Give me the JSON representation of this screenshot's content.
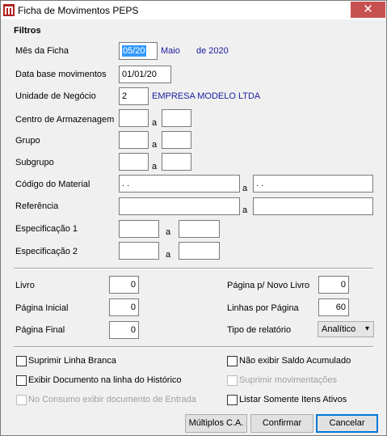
{
  "window": {
    "title": "Ficha de Movimentos PEPS",
    "close_glyph": "✕",
    "app_icon": "peps-app-icon"
  },
  "filters": {
    "group_title": "Filtros",
    "mes_ficha": {
      "label": "Mês da Ficha",
      "value": "05/20",
      "month_name": "Maio",
      "year_text": "de 2020"
    },
    "data_base": {
      "label": "Data base movimentos",
      "value": "01/01/20"
    },
    "unidade": {
      "label": "Unidade de Negócio",
      "value": "2",
      "description": "EMPRESA MODELO LTDA"
    },
    "centro": {
      "label": "Centro de Armazenagem",
      "from": "",
      "to": ""
    },
    "grupo": {
      "label": "Grupo",
      "from": "",
      "to": ""
    },
    "subgrupo": {
      "label": "Subgrupo",
      "from": "",
      "to": ""
    },
    "codigo": {
      "label": "Código do Material",
      "from": "  .  .",
      "to": "  .  ."
    },
    "referencia": {
      "label": "Referência",
      "from": "",
      "to": ""
    },
    "espec1": {
      "label": "Especificação 1",
      "from": "",
      "to": ""
    },
    "espec2": {
      "label": "Especificação 2",
      "from": "",
      "to": ""
    },
    "range_sep": "a"
  },
  "report": {
    "livro": {
      "label": "Livro",
      "value": "0"
    },
    "pagina_inicial": {
      "label": "Página Inicial",
      "value": "0"
    },
    "pagina_final": {
      "label": "Página Final",
      "value": "0"
    },
    "pagina_novo_livro": {
      "label": "Página p/ Novo Livro",
      "value": "0"
    },
    "linhas_por_pagina": {
      "label": "Linhas por Página",
      "value": "60"
    },
    "tipo_relatorio": {
      "label": "Tipo de relatório",
      "value": "Analítico"
    }
  },
  "options": {
    "suprimir_linha_branca": {
      "label": "Suprimir Linha Branca",
      "checked": false,
      "enabled": true
    },
    "exibir_documento": {
      "label": "Exibir Documento na linha do Histórico",
      "checked": false,
      "enabled": true
    },
    "consumo_documento": {
      "label": "No Consumo exibir documento de Entrada",
      "checked": false,
      "enabled": false
    },
    "nao_exibir_saldo": {
      "label": "Não exibir Saldo Acumulado",
      "checked": false,
      "enabled": true
    },
    "suprimir_movimentacoes": {
      "label": "Suprimir movimentações",
      "checked": false,
      "enabled": false
    },
    "listar_ativos": {
      "label": "Listar Somente Itens Ativos",
      "checked": false,
      "enabled": true
    }
  },
  "buttons": {
    "multiplos": "Múltiplos C.A.",
    "confirmar": "Confirmar",
    "cancelar": "Cancelar"
  }
}
